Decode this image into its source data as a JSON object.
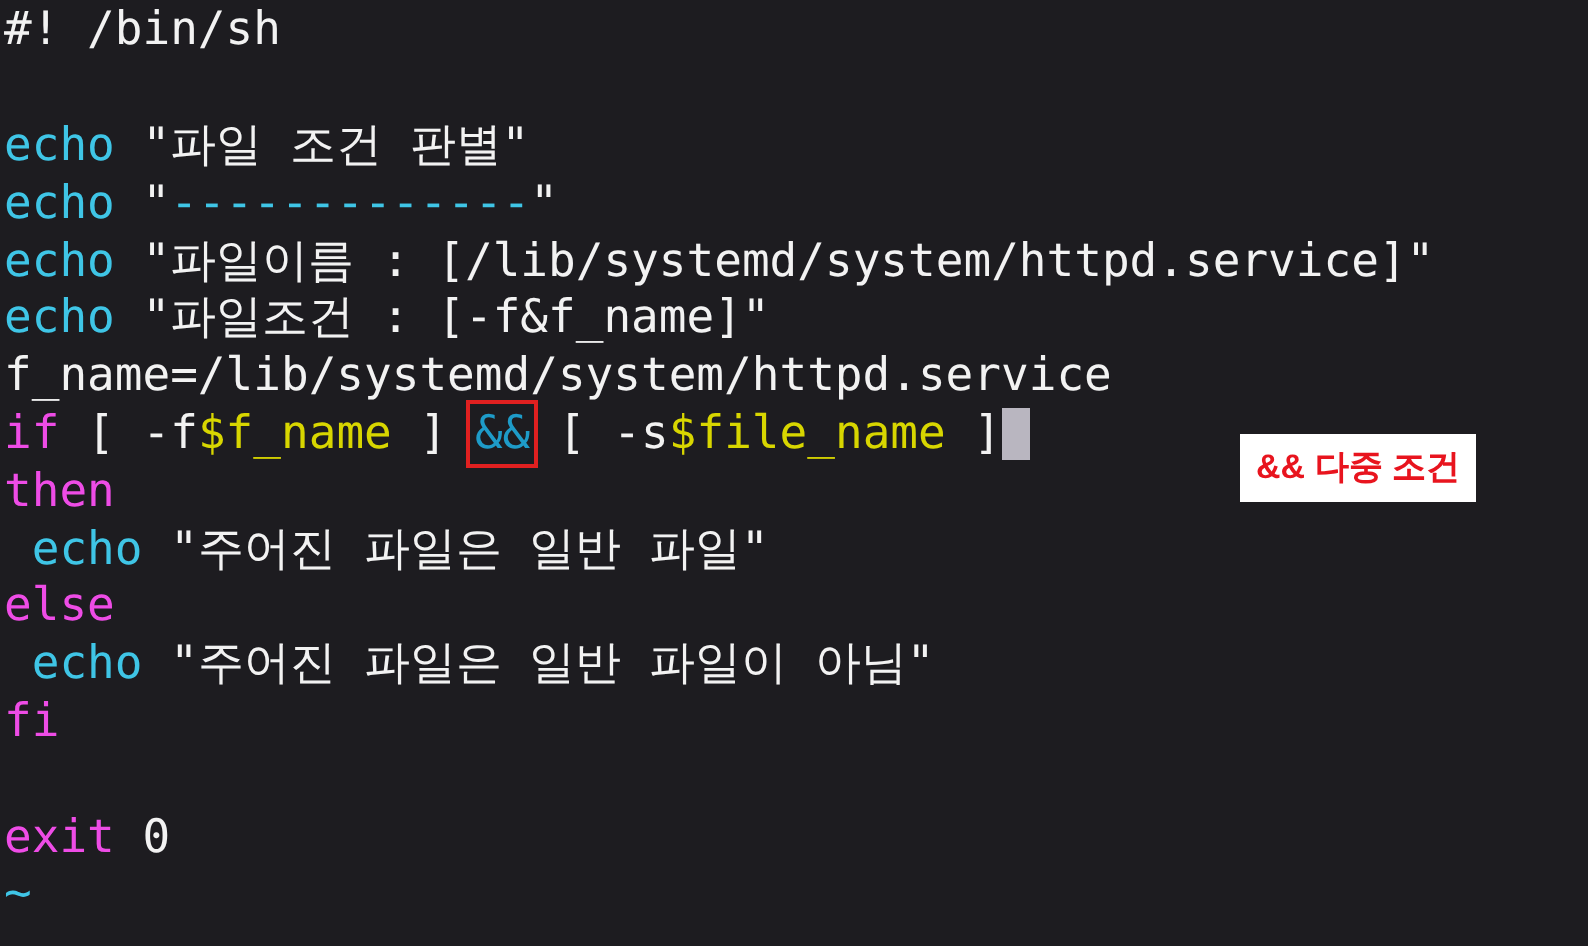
{
  "lines": [
    {
      "kind": "code",
      "cursor": false,
      "segments": [
        {
          "kind": "plain",
          "text": "#! /bin/sh"
        }
      ]
    },
    {
      "kind": "blank",
      "cursor": false
    },
    {
      "kind": "code",
      "cursor": false,
      "segments": [
        {
          "kind": "builtin",
          "text": "echo"
        },
        {
          "kind": "plain",
          "text": " \"파일 조건 판별\""
        }
      ]
    },
    {
      "kind": "code",
      "cursor": false,
      "segments": [
        {
          "kind": "builtin",
          "text": "echo"
        },
        {
          "kind": "plain",
          "text": " \""
        },
        {
          "kind": "builtin",
          "text": "-------------"
        },
        {
          "kind": "plain",
          "text": "\""
        }
      ]
    },
    {
      "kind": "code",
      "cursor": false,
      "segments": [
        {
          "kind": "builtin",
          "text": "echo"
        },
        {
          "kind": "plain",
          "text": " \"파일이름 : [/lib/systemd/system/httpd.service]\""
        }
      ]
    },
    {
      "kind": "code",
      "cursor": false,
      "segments": [
        {
          "kind": "builtin",
          "text": "echo"
        },
        {
          "kind": "plain",
          "text": " \"파일조건 : [-f&f_name]\""
        }
      ]
    },
    {
      "kind": "code",
      "cursor": false,
      "segments": [
        {
          "kind": "plain",
          "text": "f_name=/lib/systemd/system/httpd.service"
        }
      ]
    },
    {
      "kind": "code",
      "cursor": true,
      "segments": [
        {
          "kind": "keyword",
          "text": "if"
        },
        {
          "kind": "plain",
          "text": " [ -f"
        },
        {
          "kind": "variable",
          "text": "$f_name"
        },
        {
          "kind": "plain",
          "text": " ] "
        },
        {
          "kind": "boxed",
          "text": "&&"
        },
        {
          "kind": "plain",
          "text": " [ -s"
        },
        {
          "kind": "variable",
          "text": "$file_name"
        },
        {
          "kind": "plain",
          "text": " ]"
        }
      ]
    },
    {
      "kind": "code",
      "cursor": false,
      "segments": [
        {
          "kind": "keyword",
          "text": "then"
        }
      ]
    },
    {
      "kind": "code",
      "cursor": false,
      "segments": [
        {
          "kind": "builtin",
          "text": " echo"
        },
        {
          "kind": "plain",
          "text": " \"주어진 파일은 일반 파일\""
        }
      ]
    },
    {
      "kind": "code",
      "cursor": false,
      "segments": [
        {
          "kind": "keyword",
          "text": "else"
        }
      ]
    },
    {
      "kind": "code",
      "cursor": false,
      "segments": [
        {
          "kind": "builtin",
          "text": " echo"
        },
        {
          "kind": "plain",
          "text": " \"주어진 파일은 일반 파일이 아님\""
        }
      ]
    },
    {
      "kind": "code",
      "cursor": false,
      "segments": [
        {
          "kind": "keyword",
          "text": "fi"
        }
      ]
    },
    {
      "kind": "blank",
      "cursor": false
    },
    {
      "kind": "code",
      "cursor": false,
      "segments": [
        {
          "kind": "keyword",
          "text": "exit"
        },
        {
          "kind": "plain",
          "text": " 0"
        }
      ]
    },
    {
      "kind": "code",
      "cursor": false,
      "segments": [
        {
          "kind": "builtin",
          "text": "~"
        }
      ]
    }
  ],
  "annotation": {
    "text": "&& 다중 조건"
  }
}
